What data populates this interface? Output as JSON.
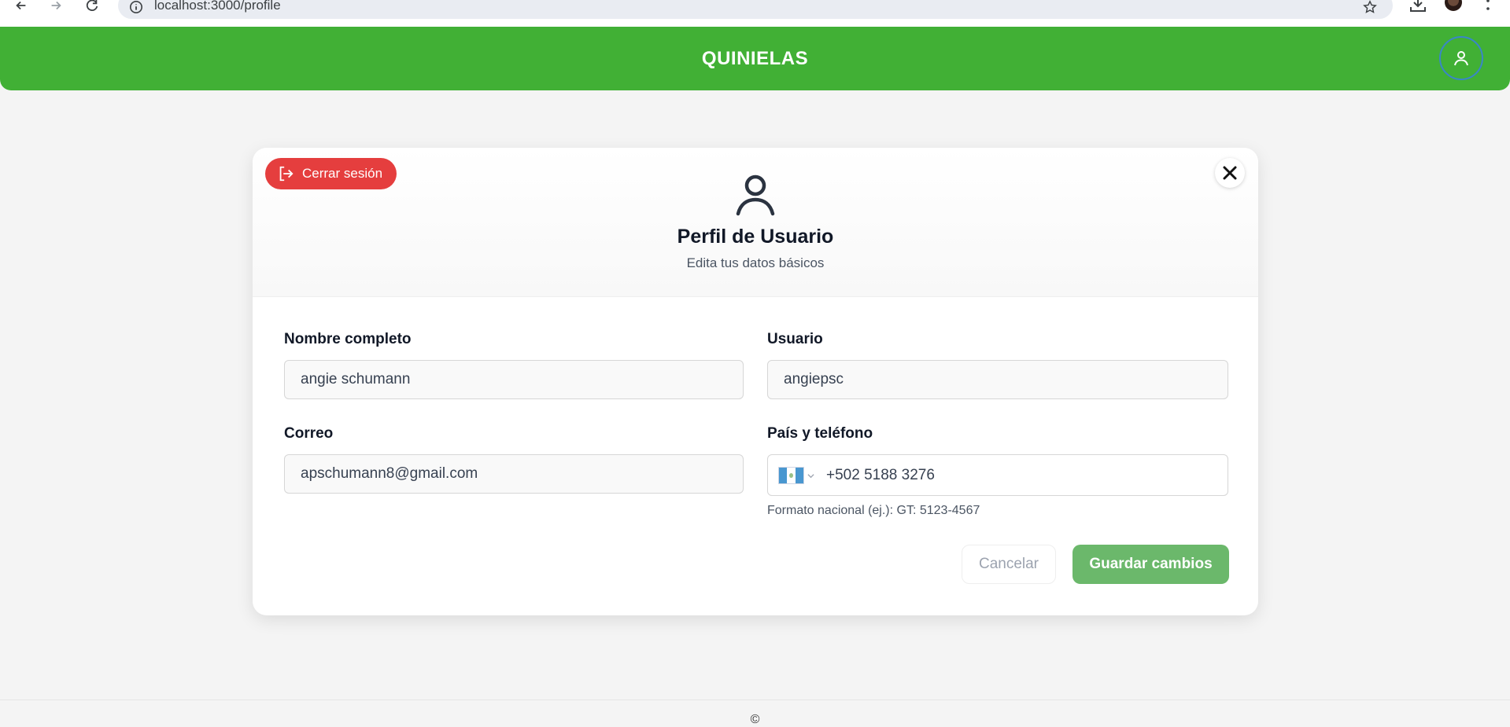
{
  "browser": {
    "url": "localhost:3000/profile",
    "icons": [
      "back-arrow-icon",
      "forward-arrow-icon",
      "reload-icon",
      "info-icon",
      "bookmark-star-icon",
      "download-icon",
      "profile-avatar-icon",
      "menu-dots-icon"
    ]
  },
  "header": {
    "brand": "QUINIELAS",
    "user_icon": "user-icon",
    "color": "#41b035"
  },
  "profile_card": {
    "logout_label": "Cerrar sesión",
    "logout_icon": "logout-icon",
    "close_icon": "close-icon",
    "avatar_icon": "user-icon",
    "title": "Perfil de Usuario",
    "subtitle": "Edita tus datos básicos"
  },
  "form": {
    "full_name": {
      "label": "Nombre completo",
      "value": "angie schumann"
    },
    "username": {
      "label": "Usuario",
      "value": "angiepsc"
    },
    "email": {
      "label": "Correo",
      "value": "apschumann8@gmail.com"
    },
    "phone": {
      "label": "País y teléfono",
      "country": "GT",
      "value": "+502 5188 3276",
      "hint": "Formato nacional (ej.): GT: 5123-4567"
    },
    "cancel_label": "Cancelar",
    "save_label": "Guardar cambios"
  },
  "colors": {
    "logout": "#e53e3e",
    "save": "#6bb86b",
    "background": "#f4f4f4"
  },
  "footer": {
    "copyright": "©"
  }
}
